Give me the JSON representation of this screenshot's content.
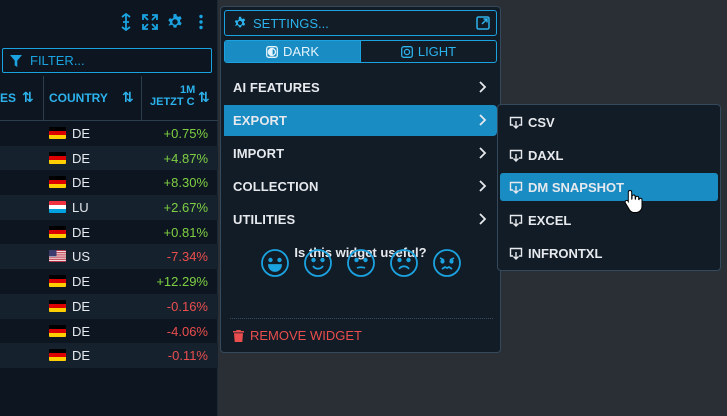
{
  "widget": {
    "filter_placeholder": "FILTER...",
    "columns": [
      {
        "label": "ES"
      },
      {
        "label": "COUNTRY"
      },
      {
        "label_line1": "1M",
        "label_line2": "JETZT C"
      }
    ],
    "rows": [
      {
        "flag": "de",
        "country": "DE",
        "change": "+0.75%",
        "dir": "pos"
      },
      {
        "flag": "de",
        "country": "DE",
        "change": "+4.87%",
        "dir": "pos"
      },
      {
        "flag": "de",
        "country": "DE",
        "change": "+8.30%",
        "dir": "pos"
      },
      {
        "flag": "lu",
        "country": "LU",
        "change": "+2.67%",
        "dir": "pos"
      },
      {
        "flag": "de",
        "country": "DE",
        "change": "+0.81%",
        "dir": "pos"
      },
      {
        "flag": "us",
        "country": "US",
        "change": "-7.34%",
        "dir": "neg"
      },
      {
        "flag": "de",
        "country": "DE",
        "change": "+12.29%",
        "dir": "pos"
      },
      {
        "flag": "de",
        "country": "DE",
        "change": "-0.16%",
        "dir": "neg"
      },
      {
        "flag": "de",
        "country": "DE",
        "change": "-4.06%",
        "dir": "neg"
      },
      {
        "flag": "de",
        "country": "DE",
        "change": "-0.11%",
        "dir": "neg"
      }
    ]
  },
  "menu": {
    "settings_label": "SETTINGS...",
    "theme": {
      "dark": "DARK",
      "light": "LIGHT",
      "selected": "DARK"
    },
    "items": [
      {
        "label": "AI FEATURES"
      },
      {
        "label": "EXPORT"
      },
      {
        "label": "IMPORT"
      },
      {
        "label": "COLLECTION"
      },
      {
        "label": "UTILITIES"
      }
    ],
    "active_item": "EXPORT",
    "feedback_question": "Is this widget useful?",
    "remove_label": "REMOVE WIDGET"
  },
  "submenu": {
    "items": [
      {
        "label": "CSV"
      },
      {
        "label": "DAXL"
      },
      {
        "label": "DM SNAPSHOT"
      },
      {
        "label": "EXCEL"
      },
      {
        "label": "INFRONTXL"
      }
    ],
    "active_item": "DM SNAPSHOT"
  },
  "colors": {
    "accent": "#1aa3e0",
    "active_bg": "#1a8cc4",
    "positive": "#7fcf43",
    "negative": "#ea4d4d",
    "panel_bg": "#121c26"
  }
}
